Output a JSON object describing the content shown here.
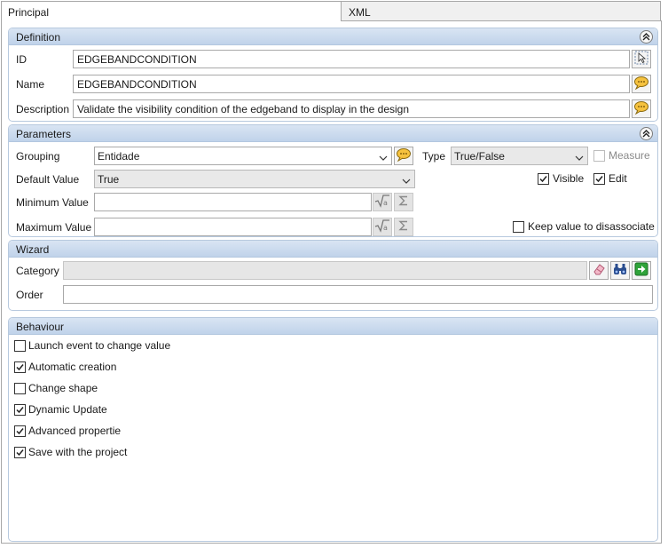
{
  "tabs": [
    {
      "label": "Principal"
    },
    {
      "label": "XML"
    }
  ],
  "definition": {
    "title": "Definition",
    "id_label": "ID",
    "id_value": "EDGEBANDCONDITION",
    "name_label": "Name",
    "name_value": "EDGEBANDCONDITION",
    "description_label": "Description",
    "description_value": "Validate the visibility condition of the edgeband to display in the design"
  },
  "parameters": {
    "title": "Parameters",
    "grouping_label": "Grouping",
    "grouping_value": "Entidade",
    "type_label": "Type",
    "type_value": "True/False",
    "measure_label": "Measure",
    "default_label": "Default Value",
    "default_value": "True",
    "visible_label": "Visible",
    "edit_label": "Edit",
    "min_label": "Minimum Value",
    "min_value": "",
    "max_label": "Maximum Value",
    "max_value": "",
    "keep_label": "Keep value to disassociate",
    "checks": {
      "measure": false,
      "visible": true,
      "edit": true,
      "keep": false
    }
  },
  "wizard": {
    "title": "Wizard",
    "category_label": "Category",
    "category_value": "",
    "order_label": "Order",
    "order_value": ""
  },
  "behaviour": {
    "title": "Behaviour",
    "items": [
      {
        "label": "Launch event to change value",
        "checked": false
      },
      {
        "label": "Automatic creation",
        "checked": true
      },
      {
        "label": "Change shape",
        "checked": false
      },
      {
        "label": "Dynamic Update",
        "checked": true
      },
      {
        "label": "Advanced propertie",
        "checked": true
      },
      {
        "label": "Save with the project",
        "checked": true
      }
    ]
  },
  "colors": {
    "group_header": "#c9d9ec",
    "group_border": "#b7c9de",
    "window_border": "#a7a7a7"
  },
  "icons": {
    "id_button": "cursor-select-icon",
    "translate": "speech-bubble-icon",
    "formula": "square-root-icon",
    "sum": "sigma-icon",
    "eraser": "eraser-icon",
    "find": "binoculars-icon",
    "go": "green-arrow-icon",
    "collapse": "double-chevron-up-icon"
  }
}
